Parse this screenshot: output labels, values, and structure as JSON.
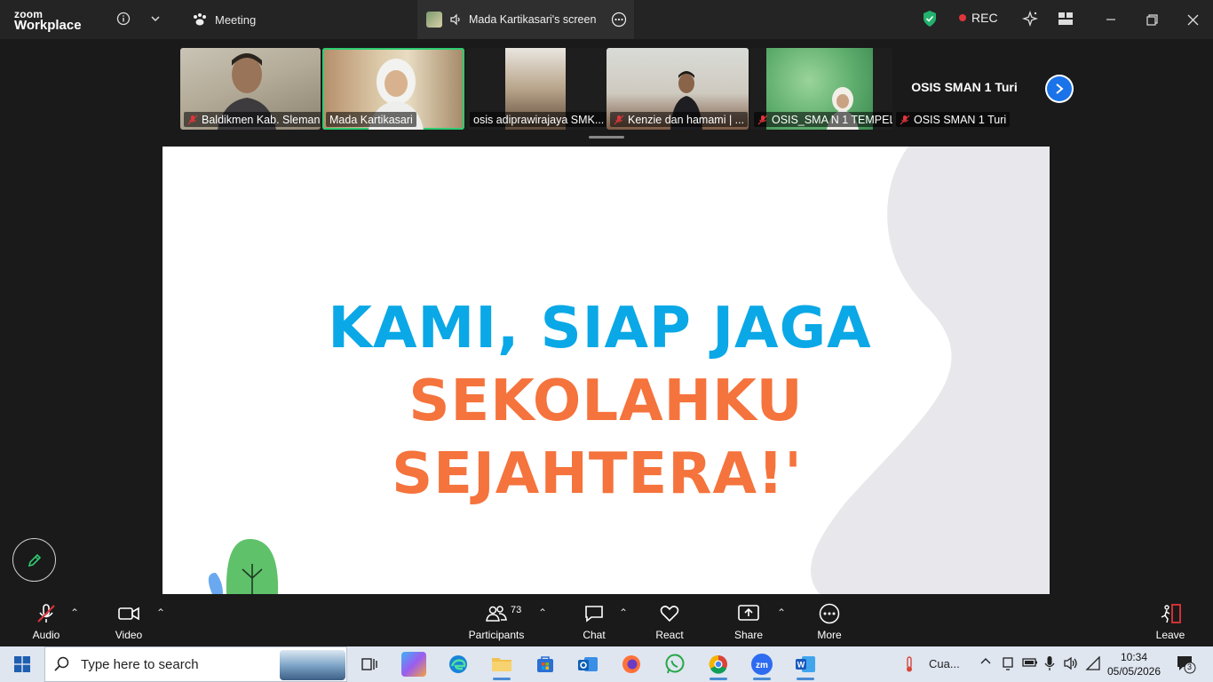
{
  "app": {
    "logo_top": "zoom",
    "logo_bottom": "Workplace",
    "meeting_tab": "Meeting",
    "screen_tab": "Mada Kartikasari's screen",
    "rec_label": "REC"
  },
  "gallery": {
    "tiles": [
      {
        "name": "Baldikmen Kab. Sleman",
        "muted": true
      },
      {
        "name": "Mada Kartikasari",
        "muted": false,
        "active": true
      },
      {
        "name": "osis adiprawirajaya SMK...",
        "muted": false
      },
      {
        "name": "Kenzie dan hamami | ...",
        "muted": true
      },
      {
        "name": "OSIS_SMA N 1 TEMPEL",
        "muted": true
      },
      {
        "name": "OSIS SMAN 1 Turi",
        "muted": true,
        "title": "OSIS SMAN 1 Turi"
      }
    ]
  },
  "slide": {
    "line1": "KAMI, SIAP JAGA",
    "line2": "SEKOLAHKU",
    "line3": "SEJAHTERA!'"
  },
  "toolbar": {
    "audio": "Audio",
    "video": "Video",
    "participants": "Participants",
    "participants_count": "73",
    "chat": "Chat",
    "react": "React",
    "share": "Share",
    "more": "More",
    "leave": "Leave"
  },
  "taskbar": {
    "search_placeholder": "Type here to search",
    "weather": "Cua...",
    "time": "10:34",
    "date": "05/05/2026",
    "notification_count": "3"
  },
  "colors": {
    "slide_blue": "#0aa8e6",
    "slide_orange": "#f5733c",
    "active_border": "#2ecc71",
    "rec_red": "#e0353a",
    "leave_red": "#e0353a"
  }
}
